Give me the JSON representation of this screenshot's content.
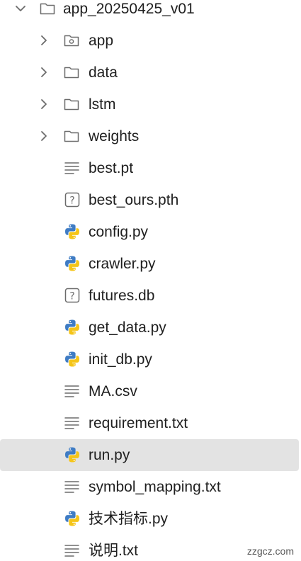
{
  "explorer": {
    "root": {
      "label": "app_20250425_v01",
      "icon": "folder-icon",
      "expanded": true
    },
    "items": [
      {
        "label": "app",
        "type": "folder",
        "icon": "folder-app-icon"
      },
      {
        "label": "data",
        "type": "folder",
        "icon": "folder-icon"
      },
      {
        "label": "lstm",
        "type": "folder",
        "icon": "folder-icon"
      },
      {
        "label": "weights",
        "type": "folder",
        "icon": "folder-icon"
      },
      {
        "label": "best.pt",
        "type": "file",
        "icon": "text-file-icon"
      },
      {
        "label": "best_ours.pth",
        "type": "file",
        "icon": "unknown-file-icon"
      },
      {
        "label": "config.py",
        "type": "file",
        "icon": "python-icon"
      },
      {
        "label": "crawler.py",
        "type": "file",
        "icon": "python-icon"
      },
      {
        "label": "futures.db",
        "type": "file",
        "icon": "unknown-file-icon"
      },
      {
        "label": "get_data.py",
        "type": "file",
        "icon": "python-icon"
      },
      {
        "label": "init_db.py",
        "type": "file",
        "icon": "python-icon"
      },
      {
        "label": "MA.csv",
        "type": "file",
        "icon": "text-file-icon"
      },
      {
        "label": "requirement.txt",
        "type": "file",
        "icon": "text-file-icon"
      },
      {
        "label": "run.py",
        "type": "file",
        "icon": "python-icon",
        "selected": true
      },
      {
        "label": "symbol_mapping.txt",
        "type": "file",
        "icon": "text-file-icon"
      },
      {
        "label": "技术指标.py",
        "type": "file",
        "icon": "python-icon"
      },
      {
        "label": "说明.txt",
        "type": "file",
        "icon": "text-file-icon"
      }
    ]
  },
  "watermark": "zzgcz.com",
  "colors": {
    "selection": "#e3e3e3",
    "icon_gray": "#6b6b6b",
    "python_blue": "#3f7cc4",
    "python_yellow": "#f5c518",
    "text": "#1f1f1f"
  }
}
